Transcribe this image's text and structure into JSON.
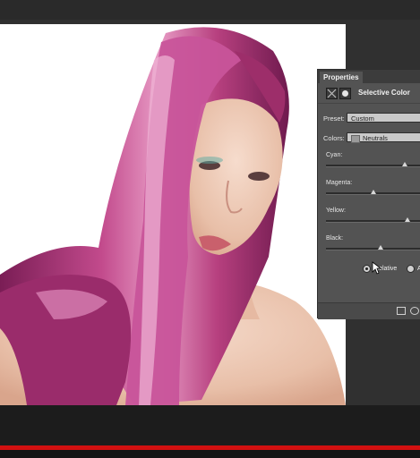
{
  "properties_panel": {
    "tab_label": "Properties",
    "adjustment_title": "Selective Color",
    "preset_label": "Preset:",
    "preset_value": "Custom",
    "colors_label": "Colors:",
    "colors_value": "Neutrals",
    "sliders": [
      {
        "label": "Cyan:",
        "level": 0.83
      },
      {
        "label": "Magenta:",
        "level": 0.5
      },
      {
        "label": "Yellow:",
        "level": 0.86
      },
      {
        "label": "Black:",
        "level": 0.58
      }
    ],
    "method": {
      "relative_label": "Relative",
      "absolute_label": "A",
      "selected": "relative"
    }
  },
  "colors": {
    "app_bg": "#2b2b2b",
    "panel_bg": "#535353",
    "accent_red": "#d21010",
    "hair": "#b5427f"
  }
}
